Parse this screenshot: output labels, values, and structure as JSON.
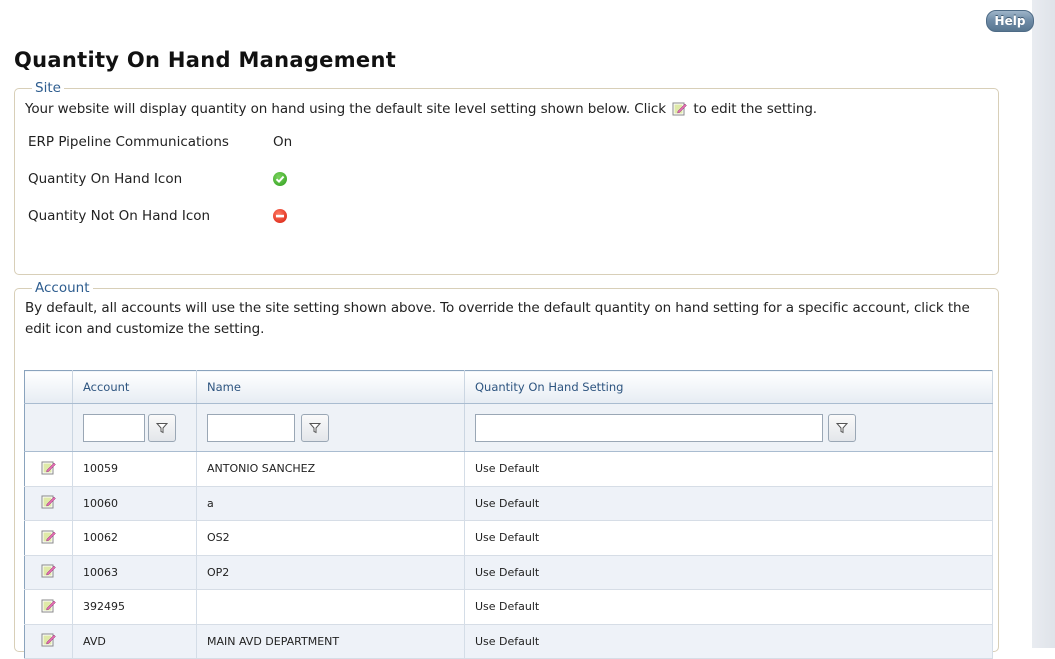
{
  "help_label": "Help",
  "page_title": "Quantity On Hand Management",
  "site": {
    "legend": "Site",
    "intro_before": "Your website will display quantity on hand using the default site level setting shown below. Click",
    "intro_after": "to edit the setting.",
    "settings": [
      {
        "label": "ERP Pipeline Communications",
        "value": "On"
      },
      {
        "label": "Quantity On Hand Icon",
        "icon": "check-circle-icon"
      },
      {
        "label": "Quantity Not On Hand Icon",
        "icon": "no-entry-icon"
      }
    ]
  },
  "account": {
    "legend": "Account",
    "intro": "By default, all accounts will use the site setting shown above. To override the default quantity on hand setting for a specific account, click the edit icon and customize the setting.",
    "columns": [
      "Account",
      "Name",
      "Quantity On Hand Setting"
    ],
    "filters": {
      "account": "",
      "name": "",
      "setting": ""
    },
    "rows": [
      {
        "account": "10059",
        "name": "ANTONIO SANCHEZ",
        "setting": "Use Default"
      },
      {
        "account": "10060",
        "name": "a",
        "setting": "Use Default"
      },
      {
        "account": "10062",
        "name": "OS2",
        "setting": "Use Default"
      },
      {
        "account": "10063",
        "name": "OP2",
        "setting": "Use Default"
      },
      {
        "account": "392495",
        "name": "",
        "setting": "Use Default"
      },
      {
        "account": "AVD",
        "name": "MAIN AVD DEPARTMENT",
        "setting": "Use Default"
      }
    ]
  },
  "colors": {
    "accent": "#2e5d8f",
    "border": "#d8cfb8",
    "grid_border": "#8aa3bd"
  }
}
